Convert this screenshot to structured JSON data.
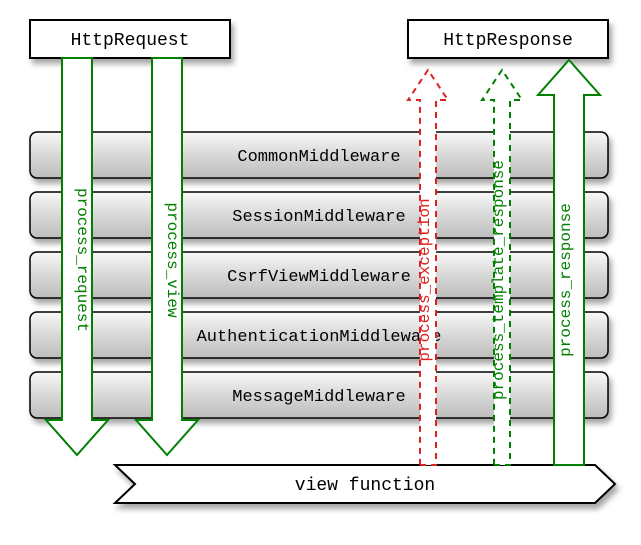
{
  "header": {
    "request_label": "HttpRequest",
    "response_label": "HttpResponse"
  },
  "middlewares": [
    "CommonMiddleware",
    "SessionMiddleware",
    "CsrfViewMiddleware",
    "AuthenticationMiddleware",
    "MessageMiddleware"
  ],
  "footer": {
    "view_label": "view function"
  },
  "arrows": {
    "process_request": "process_request",
    "process_view": "process_view",
    "process_exception": "process_exception",
    "process_template_response": "process_template_response",
    "process_response": "process_response"
  }
}
